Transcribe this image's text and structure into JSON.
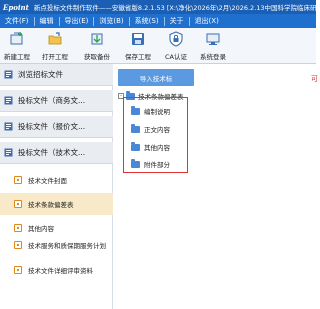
{
  "titlebar": {
    "logo": "Epoint",
    "title": "新点投标文件制作软件——安徽省版8.2.1.53    [X:\\净化\\2026年\\2月\\2026.2.13中国科学院临床研究"
  },
  "menu": [
    "文件(F)",
    "编辑",
    "导出(E)",
    "浏览(B)",
    "系统(S)",
    "关于",
    "退出(X)"
  ],
  "toolbar": [
    {
      "label": "新建工程",
      "icon": "new-project-icon"
    },
    {
      "label": "打开工程",
      "icon": "open-project-icon"
    },
    {
      "label": "获取备份",
      "icon": "get-backup-icon"
    },
    {
      "label": "保存工程",
      "icon": "save-project-icon"
    },
    {
      "label": "CA认证",
      "icon": "ca-certification-icon"
    },
    {
      "label": "系统登录",
      "icon": "system-login-icon"
    }
  ],
  "sidebar": {
    "items": [
      {
        "label": "浏览招标文件",
        "icon": "browse-icon"
      },
      {
        "label": "投标文件（商务文...",
        "icon": "doc-icon"
      },
      {
        "label": "投标文件（报价文...",
        "icon": "doc-icon"
      },
      {
        "label": "投标文件（技术文...",
        "icon": "doc-icon"
      }
    ],
    "subitems": [
      {
        "label": "技术文件封面"
      },
      {
        "label": "技术条款偏差表"
      },
      {
        "label": "其他内容"
      },
      {
        "label": "技术服务和质保期服务计划"
      },
      {
        "label": "技术文件详细评审资料"
      }
    ],
    "active_subitem": "技术条款偏差表"
  },
  "main": {
    "import_button": "导入技术标",
    "hint": "可",
    "tree": {
      "root": "技术条款偏差表",
      "toggle": "-",
      "children": [
        "编制说明",
        "正文内容",
        "其他内容",
        "附件部分"
      ]
    }
  },
  "colors": {
    "titlebar": "#1a5fb4",
    "menubar": "#1f6fce",
    "accent_button": "#5b9ae0",
    "highlight": "#d33333",
    "active_row": "#f8e9c8",
    "folder": "#4a87d6"
  }
}
